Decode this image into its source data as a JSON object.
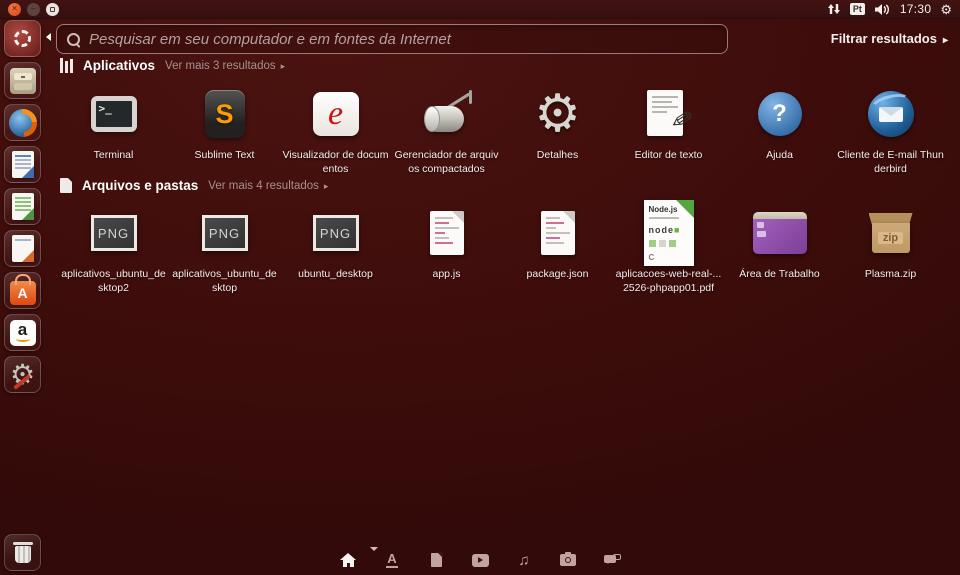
{
  "topbar": {
    "time": "17:30",
    "keyboard_layout": "Pt"
  },
  "search": {
    "placeholder": "Pesquisar em seu computador e em fontes da Internet"
  },
  "filter": {
    "label": "Filtrar resultados",
    "arrow": "▸"
  },
  "ui": {
    "more_arrow": "▸"
  },
  "sections": {
    "apps": {
      "title": "Aplicativos",
      "more": "Ver mais 3 resultados",
      "items": [
        {
          "label": "Terminal",
          "icon": "terminal-icon"
        },
        {
          "label": "Sublime Text",
          "icon": "sublime-text-icon"
        },
        {
          "label": "Visualizador de documentos",
          "icon": "document-viewer-icon"
        },
        {
          "label": "Gerenciador de arquivos compactados",
          "icon": "archive-manager-icon"
        },
        {
          "label": "Detalhes",
          "icon": "details-gear-icon"
        },
        {
          "label": "Editor de texto",
          "icon": "text-editor-icon"
        },
        {
          "label": "Ajuda",
          "icon": "help-icon"
        },
        {
          "label": "Cliente de E-mail Thunderbird",
          "icon": "thunderbird-icon"
        }
      ]
    },
    "files": {
      "title": "Arquivos e pastas",
      "more": "Ver mais 4 resultados",
      "items": [
        {
          "label": "aplicativos_ubuntu_desktop2",
          "icon": "png-thumbnail-icon"
        },
        {
          "label": "aplicativos_ubuntu_desktop",
          "icon": "png-thumbnail-icon"
        },
        {
          "label": "ubuntu_desktop",
          "icon": "png-thumbnail-icon"
        },
        {
          "label": "app.js",
          "icon": "code-file-icon"
        },
        {
          "label": "package.json",
          "icon": "code-file-icon"
        },
        {
          "label": "aplicacoes-web-real-...2526-phpapp01.pdf",
          "icon": "pdf-nodejs-icon"
        },
        {
          "label": "Área de Trabalho",
          "icon": "desktop-folder-icon"
        },
        {
          "label": "Plasma.zip",
          "icon": "zip-archive-icon"
        }
      ]
    }
  },
  "icon_text": {
    "terminal_prompt": ">_",
    "sublime_s": "S",
    "evince_e": "e",
    "help_q": "?",
    "png": "PNG",
    "zip": "zip",
    "pdf_title": "Node.js",
    "pdf_node": "node",
    "pdf_c": "C",
    "usc_a": "A",
    "amazon_a": "a",
    "gear": "⚙",
    "pencil": "✎",
    "music_note": "♫"
  },
  "launcher": {
    "items": [
      "ubuntu-dash",
      "files-cabinet",
      "firefox",
      "libreoffice-writer",
      "libreoffice-calc",
      "libreoffice-impress",
      "software-center",
      "amazon",
      "system-settings",
      "trash"
    ]
  },
  "lens_bar": {
    "icons": [
      "home",
      "applications",
      "files",
      "videos",
      "music",
      "photos",
      "social"
    ]
  },
  "colors": {
    "background": "#3E0D0B",
    "panel": "#371010",
    "accent_orange": "#DD4814",
    "text": "#F2ECEA",
    "muted_text": "#A8908D"
  }
}
